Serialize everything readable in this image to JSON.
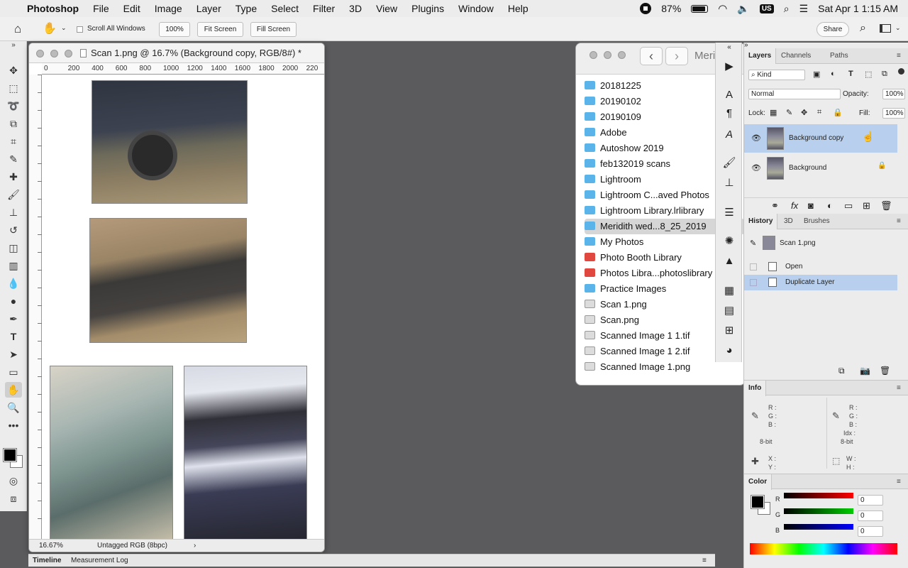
{
  "menubar": {
    "app": "Photoshop",
    "menus": [
      "File",
      "Edit",
      "Image",
      "Layer",
      "Type",
      "Select",
      "Filter",
      "3D",
      "View",
      "Plugins",
      "Window",
      "Help"
    ],
    "battery": "87%",
    "user": "US",
    "clock": "Sat Apr 1  1:15 AM"
  },
  "options": {
    "scroll_all": "Scroll All Windows",
    "zoom": "100%",
    "fit_screen": "Fit Screen",
    "fill_screen": "Fill Screen",
    "share": "Share"
  },
  "document": {
    "title": "Scan 1.png @ 16.7% (Background copy, RGB/8#) *",
    "ruler_top": [
      "0",
      "200",
      "400",
      "600",
      "800",
      "1000",
      "1200",
      "1400",
      "1600",
      "1800",
      "2000",
      "220"
    ],
    "zoom": "16.67%",
    "profile": "Untagged RGB (8bpc)"
  },
  "finder": {
    "title": "Meri",
    "items": [
      {
        "name": "20181225",
        "type": "folder"
      },
      {
        "name": "20190102",
        "type": "folder"
      },
      {
        "name": "20190109",
        "type": "folder"
      },
      {
        "name": "Adobe",
        "type": "folder"
      },
      {
        "name": "Autoshow 2019",
        "type": "folder"
      },
      {
        "name": "feb132019 scans",
        "type": "folder"
      },
      {
        "name": "Lightroom",
        "type": "folder"
      },
      {
        "name": "Lightroom C...aved Photos",
        "type": "folder"
      },
      {
        "name": "Lightroom Library.lrlibrary",
        "type": "folder"
      },
      {
        "name": "Meridith wed...8_25_2019",
        "type": "folder",
        "selected": true
      },
      {
        "name": "My Photos",
        "type": "folder"
      },
      {
        "name": "Photo Booth Library",
        "type": "app"
      },
      {
        "name": "Photos Libra...photoslibrary",
        "type": "app"
      },
      {
        "name": "Practice Images",
        "type": "folder"
      },
      {
        "name": "Scan 1.png",
        "type": "file"
      },
      {
        "name": "Scan.png",
        "type": "file"
      },
      {
        "name": "Scanned Image 1 1.tif",
        "type": "file"
      },
      {
        "name": "Scanned Image 1 2.tif",
        "type": "file"
      },
      {
        "name": "Scanned Image 1.png",
        "type": "file"
      }
    ]
  },
  "layers_panel": {
    "tabs": [
      "Layers",
      "Channels",
      "Paths"
    ],
    "kind": "Kind",
    "blend": "Normal",
    "opacity_label": "Opacity:",
    "opacity": "100%",
    "lock_label": "Lock:",
    "fill_label": "Fill:",
    "fill": "100%",
    "layers": [
      {
        "name": "Background copy",
        "selected": true
      },
      {
        "name": "Background",
        "locked": true
      }
    ]
  },
  "history_panel": {
    "tabs": [
      "History",
      "3D",
      "Brushes"
    ],
    "snapshot": "Scan 1.png",
    "steps": [
      {
        "name": "Open"
      },
      {
        "name": "Duplicate Layer",
        "selected": true
      }
    ]
  },
  "info_panel": {
    "title": "Info",
    "left": {
      "r": "R :",
      "g": "G :",
      "b": "B :",
      "mode": "8-bit",
      "x": "X :",
      "y": "Y :"
    },
    "right": {
      "r": "R :",
      "g": "G :",
      "b": "B :",
      "idx": "Idx :",
      "mode": "8-bit",
      "w": "W :",
      "h": "H :"
    }
  },
  "color_panel": {
    "title": "Color",
    "r_label": "R",
    "g_label": "G",
    "b_label": "B",
    "r": "0",
    "g": "0",
    "b": "0"
  },
  "bottom": {
    "timeline": "Timeline",
    "measurement": "Measurement Log"
  },
  "colors": {
    "selection_blue": "#b8d0ee",
    "folder_blue": "#5ab4ea"
  }
}
